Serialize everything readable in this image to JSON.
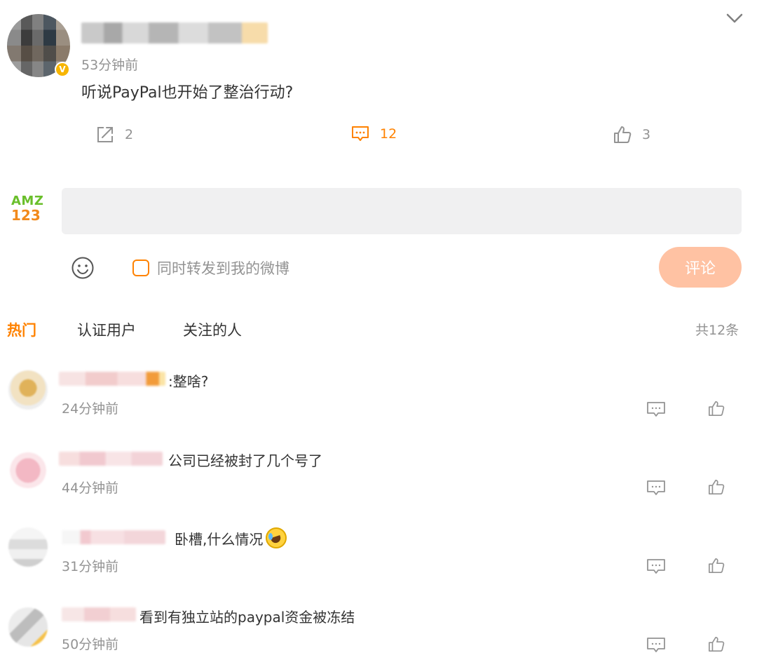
{
  "post": {
    "time": "53分钟前",
    "text": "听说PayPal也开始了整治行动?",
    "actions": {
      "repost_count": "2",
      "comment_count": "12",
      "like_count": "3"
    }
  },
  "composer": {
    "logo_line1": "AMZ",
    "logo_line2": "123",
    "input_value": "",
    "repost_label": "同时转发到我的微博",
    "submit_label": "评论"
  },
  "tabs": {
    "hot": "热门",
    "verified": "认证用户",
    "following": "关注的人",
    "total": "共12条"
  },
  "comments": [
    {
      "text": ":整啥?",
      "time": "24分钟前"
    },
    {
      "text": "公司已经被封了几个号了",
      "time": "44分钟前"
    },
    {
      "text": "卧槽,什么情况",
      "time": "31分钟前"
    },
    {
      "text": "看到有独立站的paypal资金被冻结",
      "time": "50分钟前"
    }
  ],
  "icons": {
    "repost": "share-icon",
    "comment": "comment-icon",
    "like": "thumbs-up-icon",
    "emoji": "smiley-icon",
    "collapse": "chevron-down-icon"
  },
  "colors": {
    "accent": "#ff8200",
    "muted": "#939393",
    "submit_disabled": "#ffc2a3"
  }
}
